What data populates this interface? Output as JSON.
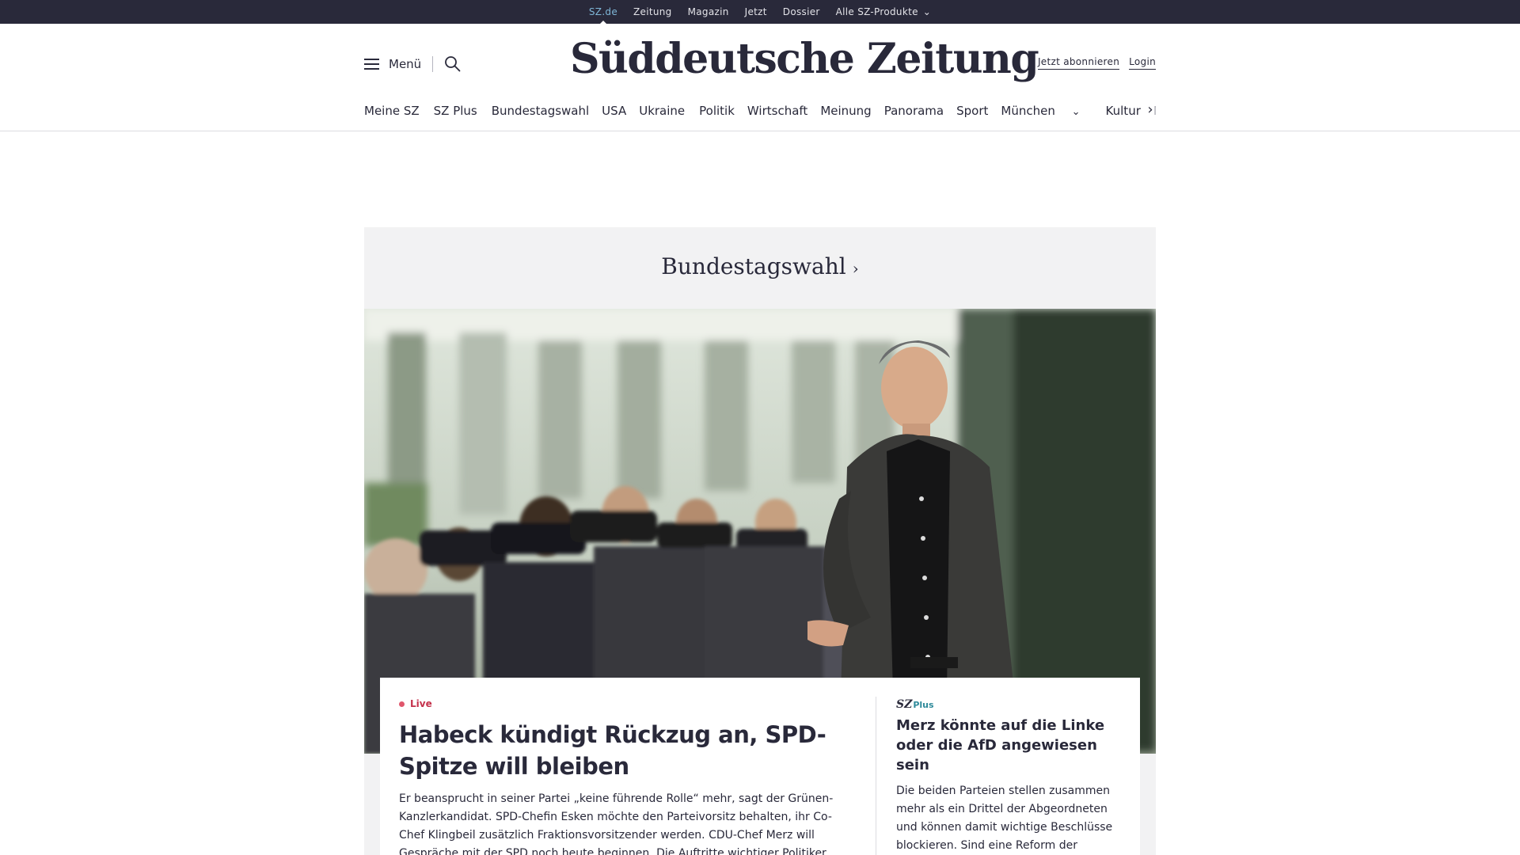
{
  "topbar": {
    "links": [
      "SZ.de",
      "Zeitung",
      "Magazin",
      "Jetzt",
      "Dossier"
    ],
    "products_label": "Alle SZ-Produkte"
  },
  "header": {
    "menu_label": "Menü",
    "logo_text": "Süddeutsche Zeitung",
    "subscribe_label": "Jetzt abonnieren",
    "login_label": "Login"
  },
  "nav": {
    "items": [
      "Meine SZ",
      "SZ Plus",
      "Bundestagswahl",
      "USA",
      "Ukraine",
      "Politik",
      "Wirtschaft",
      "Meinung",
      "Panorama",
      "Sport",
      "München",
      "Kultur",
      "M"
    ]
  },
  "hero": {
    "section_title": "Bundestagswahl",
    "live_label": "Live",
    "headline": "Habeck kündigt Rückzug an, SPD-Spitze will bleiben",
    "teaser": "Er beansprucht in seiner Partei „keine führende Rolle“ mehr, sagt der Grünen-Kanzlerkandidat. SPD-Chefin Esken möchte den Parteivorsitz behalten, ihr Co-Chef Klingbeil zusätzlich Fraktionsvorsitzender werden. CDU-Chef Merz will Gespräche mit der SPD noch heute beginnen. Die Auftritte wichtiger Politiker im Livestream."
  },
  "side_article": {
    "brand_sz": "SZ",
    "brand_plus": "Plus",
    "headline": "Merz könnte auf die Linke oder die AfD angewiesen sein",
    "teaser": "Die beiden Parteien stellen zusammen mehr als ein Drittel der Abgeordneten und können damit wichtige Beschlüsse blockieren. Sind eine Reform der Schuldenbremse und höhere Verteidigungsetats noch möglich?"
  }
}
